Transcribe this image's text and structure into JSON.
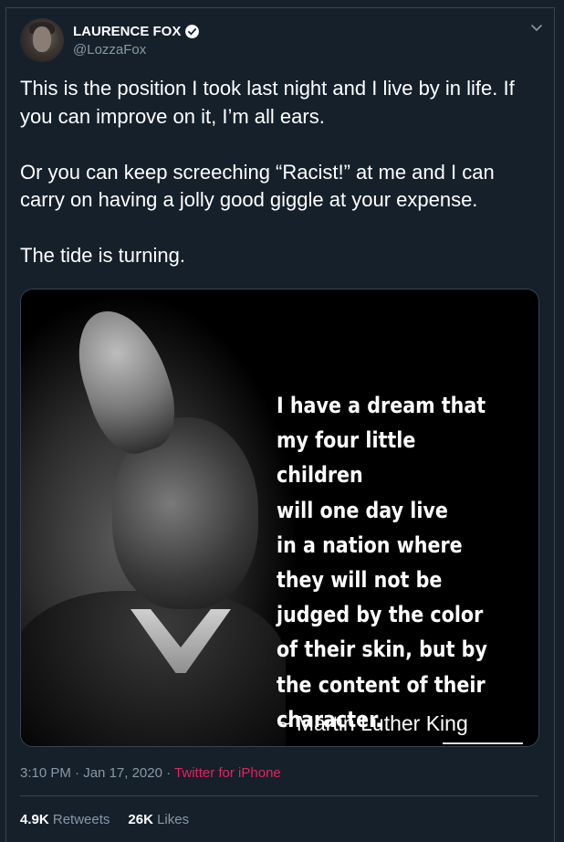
{
  "user": {
    "name": "LAURENCE FOX",
    "handle": "@LozzaFox"
  },
  "tweet": {
    "text": "This is the position I took last night and I live by in life. If you can improve on it, I’m all ears.\n\nOr you can keep screeching “Racist!” at me and I can carry on having a jolly good giggle at your expense.\n\nThe tide is turning.",
    "time": "3:10 PM",
    "separator1": " · ",
    "date": "Jan 17, 2020",
    "separator2": " · ",
    "source": "Twitter for iPhone"
  },
  "media": {
    "quote": "I have a dream that\nmy four little children\nwill one day live\nin a nation where\nthey will not be\njudged by the color\nof their skin, but by\nthe content of their\ncharacter.",
    "attribution": "~ Martin Luther King"
  },
  "stats": {
    "retweets_count": "4.9K",
    "retweets_label": "Retweets",
    "likes_count": "26K",
    "likes_label": "Likes"
  },
  "icons": {
    "verified": "verified-badge-icon",
    "caret": "chevron-down-icon"
  },
  "colors": {
    "background": "#15202b",
    "secondary_text": "#8899a6",
    "source_link": "#e0245e",
    "border": "#38444d"
  }
}
